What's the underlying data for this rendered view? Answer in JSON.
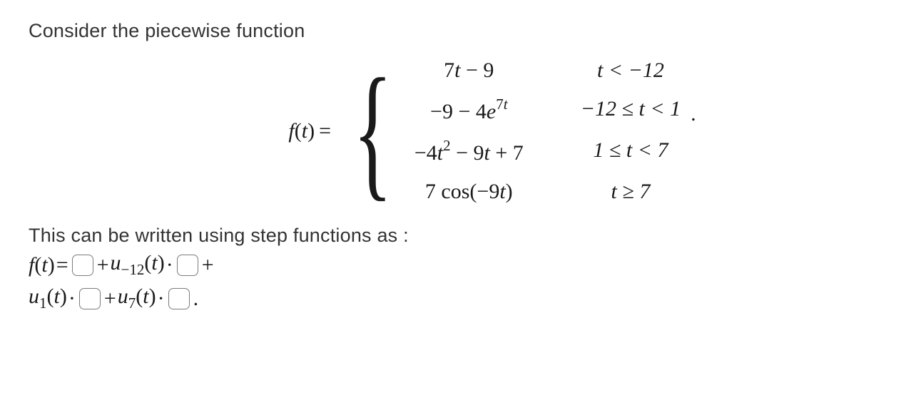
{
  "intro": "Consider the piecewise function",
  "lhs": {
    "f": "f",
    "arg": "t",
    "eq": "="
  },
  "pieces": {
    "r1": {
      "expr_a": "7",
      "expr_b": "t",
      "expr_c": " − 9",
      "cond": "t < −12"
    },
    "r2": {
      "expr_a": "−9 − 4",
      "expr_b": "e",
      "exp1": "7",
      "exp2": "t",
      "cond": "−12 ≤ t < 1"
    },
    "r3": {
      "expr_a": "−4",
      "expr_b": "t",
      "sq": "2",
      "expr_c": " − 9",
      "expr_d": "t",
      "expr_e": " + 7",
      "cond": "1 ≤ t < 7"
    },
    "r4": {
      "expr_a": "7 cos(−9",
      "expr_b": "t",
      "expr_c": ")",
      "cond": "t ≥ 7"
    }
  },
  "trailing_period": ".",
  "follow": "This can be written using step functions as :",
  "answer": {
    "f": "f",
    "t": "t",
    "eq": " = ",
    "plus": " + ",
    "u": "u",
    "s_neg12": "−12",
    "s_1": "1",
    "s_7": "7",
    "open": "(",
    "close": ")",
    "dot": "·",
    "plus_trail": " +",
    "final_period": "."
  }
}
